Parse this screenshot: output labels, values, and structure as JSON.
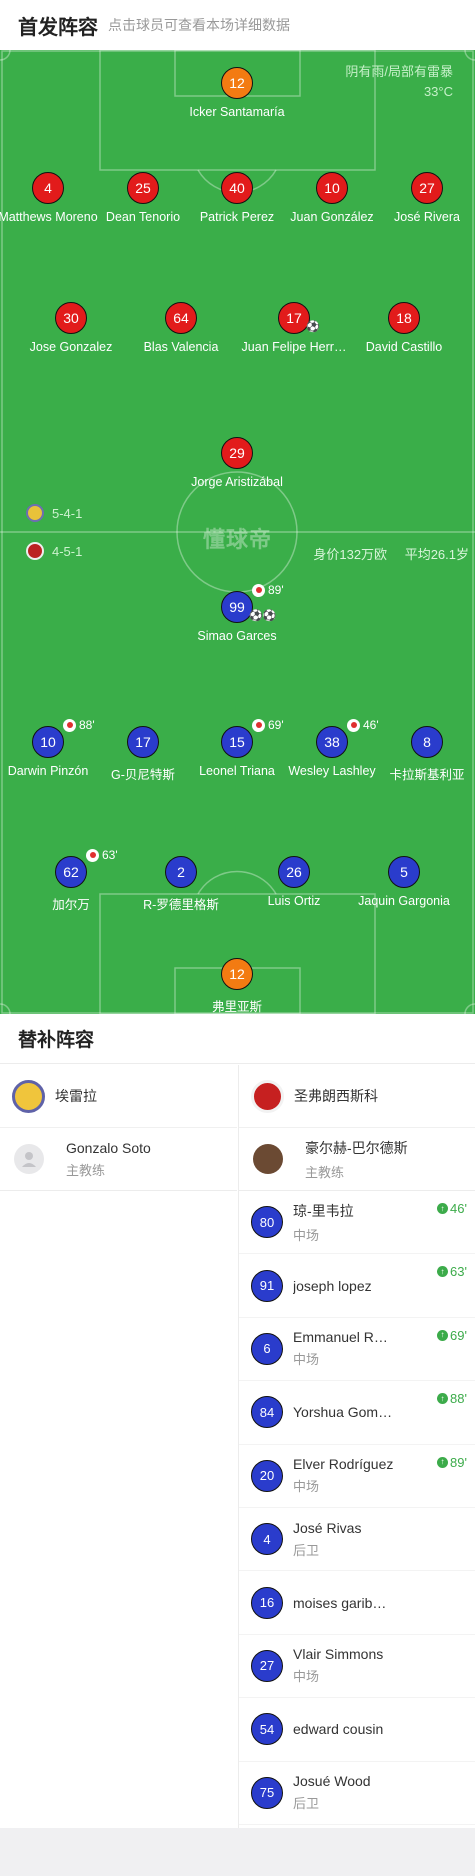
{
  "header": {
    "title": "首发阵容",
    "hint": "点击球员可查看本场详细数据"
  },
  "weather": {
    "condition": "阴有雨/局部有雷暴",
    "temperature": "33°C"
  },
  "watermark": "懂球帝",
  "home": {
    "formation": "5-4-1",
    "name": "埃雷拉",
    "lineup": [
      {
        "number": "12",
        "name": "Icker Santamaría",
        "color": "orange"
      },
      {
        "number": "4",
        "name": "Matthews Moreno",
        "color": "red"
      },
      {
        "number": "25",
        "name": "Dean Tenorio",
        "color": "red"
      },
      {
        "number": "40",
        "name": "Patrick Perez",
        "color": "red"
      },
      {
        "number": "10",
        "name": "Juan González",
        "color": "red"
      },
      {
        "number": "27",
        "name": "José Rivera",
        "color": "red"
      },
      {
        "number": "30",
        "name": "Jose Gonzalez",
        "color": "red"
      },
      {
        "number": "64",
        "name": "Blas Valencia",
        "color": "red"
      },
      {
        "number": "17",
        "name": "Juan Felipe Herr…",
        "color": "red",
        "goal": "⚽"
      },
      {
        "number": "18",
        "name": "David Castillo",
        "color": "red"
      },
      {
        "number": "29",
        "name": "Jorge Aristizábal",
        "color": "red"
      }
    ],
    "coach": {
      "name": "Gonzalo Soto",
      "role": "主教练"
    }
  },
  "away": {
    "formation": "4-5-1",
    "name": "圣弗朗西斯科",
    "value": "身价132万欧",
    "avg_age": "平均26.1岁",
    "lineup": [
      {
        "number": "99",
        "name": "Simao Garces",
        "color": "blue",
        "sub": "89'",
        "goal": "⚽⚽"
      },
      {
        "number": "10",
        "name": "Darwin Pinzón",
        "color": "blue",
        "sub": "88'"
      },
      {
        "number": "17",
        "name": "G-贝尼特斯",
        "color": "blue"
      },
      {
        "number": "15",
        "name": "Leonel Triana",
        "color": "blue",
        "sub": "69'"
      },
      {
        "number": "38",
        "name": "Wesley Lashley",
        "color": "blue",
        "sub": "46'"
      },
      {
        "number": "8",
        "name": "卡拉斯基利亚",
        "color": "blue"
      },
      {
        "number": "62",
        "name": "加尔万",
        "color": "blue",
        "sub": "63'"
      },
      {
        "number": "2",
        "name": "R-罗德里格斯",
        "color": "blue"
      },
      {
        "number": "26",
        "name": "Luis Ortiz",
        "color": "blue"
      },
      {
        "number": "5",
        "name": "Jaquin Gargonia",
        "color": "blue"
      },
      {
        "number": "12",
        "name": "弗里亚斯",
        "color": "orange"
      }
    ],
    "coach": {
      "name": "豪尔赫-巴尔德斯",
      "role": "主教练"
    },
    "subs": [
      {
        "number": "80",
        "name": "琼-里韦拉",
        "role": "中场",
        "minute": "46'"
      },
      {
        "number": "91",
        "name": "joseph lopez",
        "role": "",
        "minute": "63'"
      },
      {
        "number": "6",
        "name": "Emmanuel R…",
        "role": "中场",
        "minute": "69'"
      },
      {
        "number": "84",
        "name": "Yorshua Gom…",
        "role": "",
        "minute": "88'"
      },
      {
        "number": "20",
        "name": "Elver Rodríguez",
        "role": "中场",
        "minute": "89'"
      },
      {
        "number": "4",
        "name": "José Rivas",
        "role": "后卫",
        "minute": ""
      },
      {
        "number": "16",
        "name": "moises garib…",
        "role": "",
        "minute": ""
      },
      {
        "number": "27",
        "name": "Vlair Simmons",
        "role": "中场",
        "minute": ""
      },
      {
        "number": "54",
        "name": "edward cousin",
        "role": "",
        "minute": ""
      },
      {
        "number": "75",
        "name": "Josué Wood",
        "role": "后卫",
        "minute": ""
      }
    ]
  },
  "subs_title": "替补阵容",
  "colors": {
    "pitch": "#3aae49",
    "home": "#e21b1b",
    "away": "#2a3ccc",
    "keeper": "#f37b12",
    "sub_in": "#3cab4a"
  }
}
